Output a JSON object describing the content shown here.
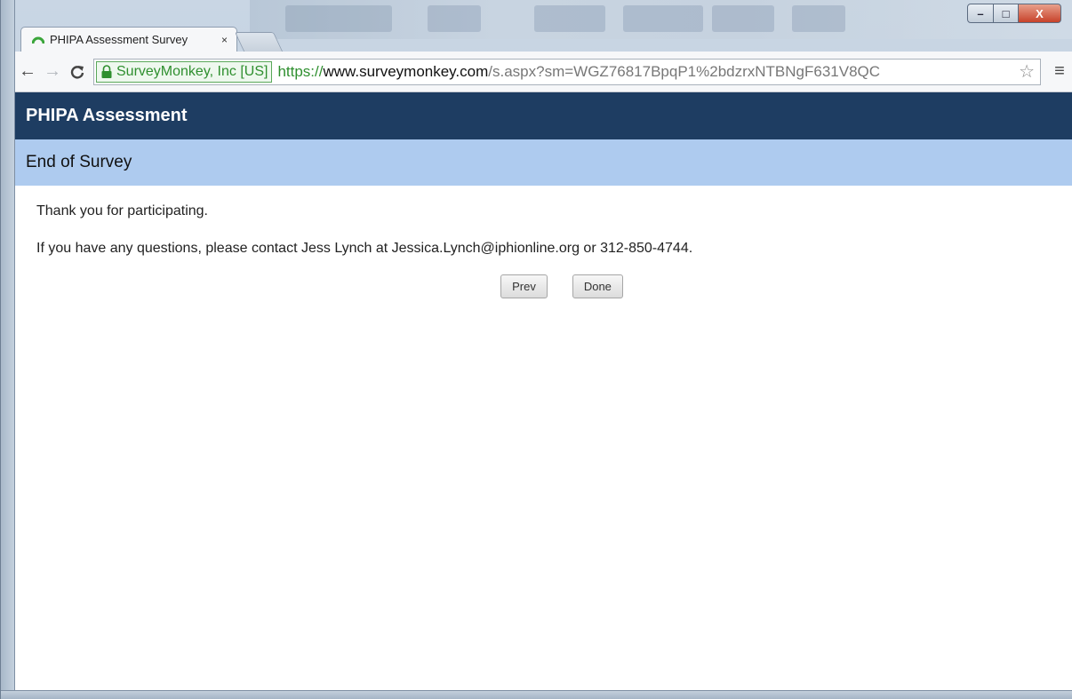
{
  "browser": {
    "tab_title": "PHIPA Assessment Survey",
    "tab_close": "×",
    "ev_cert": "SurveyMonkey, Inc [US]",
    "url_scheme": "https://",
    "url_host": "www.surveymonkey.com",
    "url_path": "/s.aspx?sm=WGZ76817BpqP1%2bdzrxNTBNgF631V8QC",
    "controls": {
      "minimize": "–",
      "maximize": "□",
      "close": "X"
    }
  },
  "icons": {
    "back": "back-arrow-icon",
    "forward": "forward-arrow-icon",
    "reload": "reload-icon",
    "lock": "lock-icon",
    "star": "star-icon",
    "menu": "menu-icon",
    "tab_favicon": "surveymonkey-favicon-icon"
  },
  "colors": {
    "survey_header": "#1e3d62",
    "page_header": "#aecbef",
    "secure_green": "#2f8f2f"
  },
  "survey": {
    "title": "PHIPA Assessment",
    "page_title": "End of Survey",
    "thank_you": "Thank you for participating.",
    "contact": "If you have any questions, please contact Jess Lynch at Jessica.Lynch@iphionline.org or 312-850-4744.",
    "prev_label": "Prev",
    "done_label": "Done"
  }
}
